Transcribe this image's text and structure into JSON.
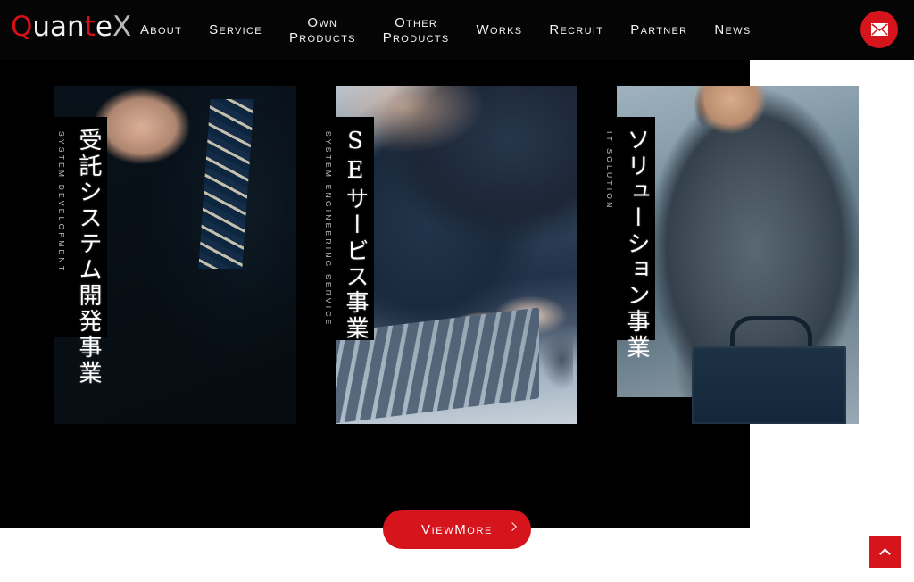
{
  "site": {
    "logo": {
      "full_text": "Quantex",
      "parts": [
        {
          "text": "Q",
          "color": "#d31017"
        },
        {
          "text": "uan",
          "color": "#f2f2f2"
        },
        {
          "text": "t",
          "color": "#d31017"
        },
        {
          "text": "e",
          "color": "#f2f2f2"
        },
        {
          "text": "X",
          "color": "#b9b9b9"
        }
      ]
    },
    "accent_color": "#d6141c",
    "header_background": "#050505"
  },
  "nav": {
    "items": [
      {
        "id": "about",
        "line1": "About",
        "line2": ""
      },
      {
        "id": "service",
        "line1": "Service",
        "line2": ""
      },
      {
        "id": "own-products",
        "line1": "Own",
        "line2": "Products"
      },
      {
        "id": "other-products",
        "line1": "Other",
        "line2": "Products"
      },
      {
        "id": "works",
        "line1": "Works",
        "line2": ""
      },
      {
        "id": "recruit",
        "line1": "Recruit",
        "line2": ""
      },
      {
        "id": "partner",
        "line1": "Partner",
        "line2": ""
      },
      {
        "id": "news",
        "line1": "News",
        "line2": ""
      }
    ],
    "contact_icon": "mail-icon"
  },
  "services": {
    "cards": [
      {
        "id": "system-development",
        "title_ja": "受託システム開発事業",
        "subtitle_en": "SYSTEM DEVELOPMENT",
        "image_alt": "businesswoman in teal cardigan holding burgundy notebook with colleague in striped tie"
      },
      {
        "id": "se-service",
        "title_ja": "SEサービス事業",
        "subtitle_en": "SYSTEM ENGINEERING SERVICE",
        "image_alt": "hands typing on a laptop keyboard with blurred business people behind"
      },
      {
        "id": "it-solution",
        "title_ja": "ソリューション事業",
        "subtitle_en": "IT SOLUTION",
        "image_alt": "businessman in grey suit on mobile phone holding navy briefcase outdoors"
      }
    ]
  },
  "actions": {
    "view_more_label": "ViewMore",
    "view_more_icon": "chevron-right-icon",
    "scroll_top_icon": "chevron-up-icon"
  }
}
